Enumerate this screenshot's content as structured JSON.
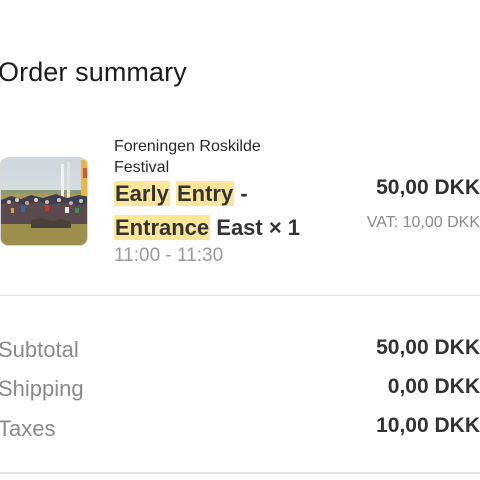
{
  "heading": "Order summary",
  "line_item": {
    "vendor": "Foreningen Roskilde Festival",
    "product_parts": {
      "w1": "Early",
      "w2": "Entry",
      "w3": " -",
      "w4": "Entrance",
      "w5": " East × 1"
    },
    "time": "11:00 - 11:30",
    "price": "50,00 DKK",
    "vat": "VAT: 10,00 DKK",
    "thumbnail": "festival-crowd-photo"
  },
  "totals": [
    {
      "label": "Subtotal",
      "value": "50,00 DKK"
    },
    {
      "label": "Shipping",
      "value": "0,00 DKK"
    },
    {
      "label": "Taxes",
      "value": "10,00 DKK"
    }
  ],
  "colors": {
    "highlight": "#fbe69a",
    "muted_text": "#8a8a8a",
    "divider": "#e3e3e3"
  }
}
